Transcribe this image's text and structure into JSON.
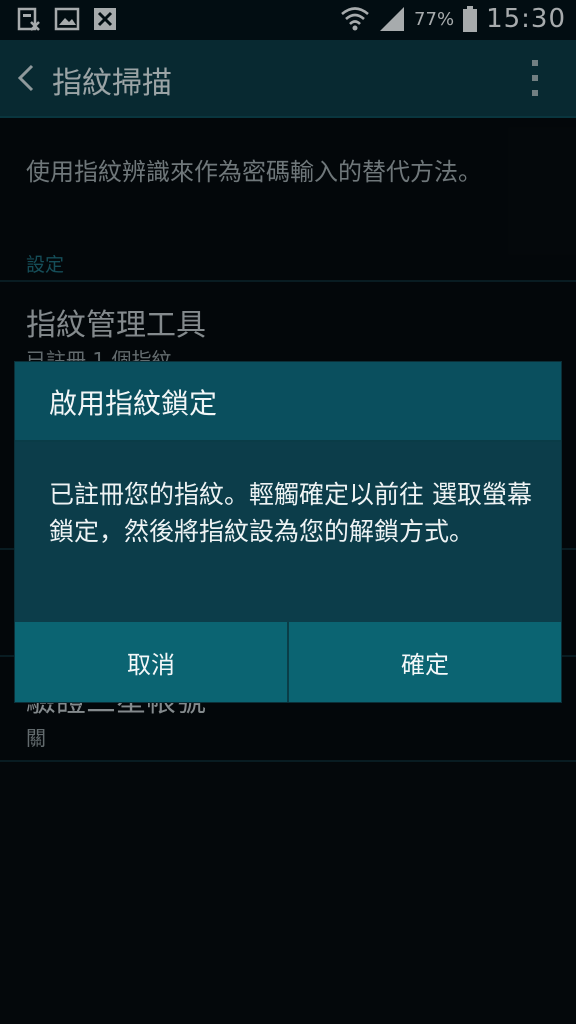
{
  "status_bar": {
    "battery_percent": "77%",
    "time": "15:30",
    "icons": [
      "screenshot-icon",
      "gallery-icon",
      "download-icon",
      "wifi-icon",
      "signal-icon",
      "battery-icon"
    ]
  },
  "action_bar": {
    "title": "指紋掃描"
  },
  "content": {
    "description": "使用指紋辨識來作為密碼輸入的替代方法。",
    "section_header": "設定",
    "items": [
      {
        "title": "指紋管理工具",
        "subtitle": "已註冊 1 個指紋"
      },
      {
        "title": "驗證三星帳號",
        "subtitle": "關"
      }
    ]
  },
  "dialog": {
    "title": "啟用指紋鎖定",
    "message": "已註冊您的指紋。輕觸確定以前往 選取螢幕鎖定，然後將指紋設為您的解鎖方式。",
    "cancel_label": "取消",
    "ok_label": "確定"
  },
  "colors": {
    "action_bar_bg": "#0c3a45",
    "dialog_bg": "#0c3d4a",
    "button_bar_bg": "#0b6472",
    "section_header": "#1e6b7a"
  }
}
